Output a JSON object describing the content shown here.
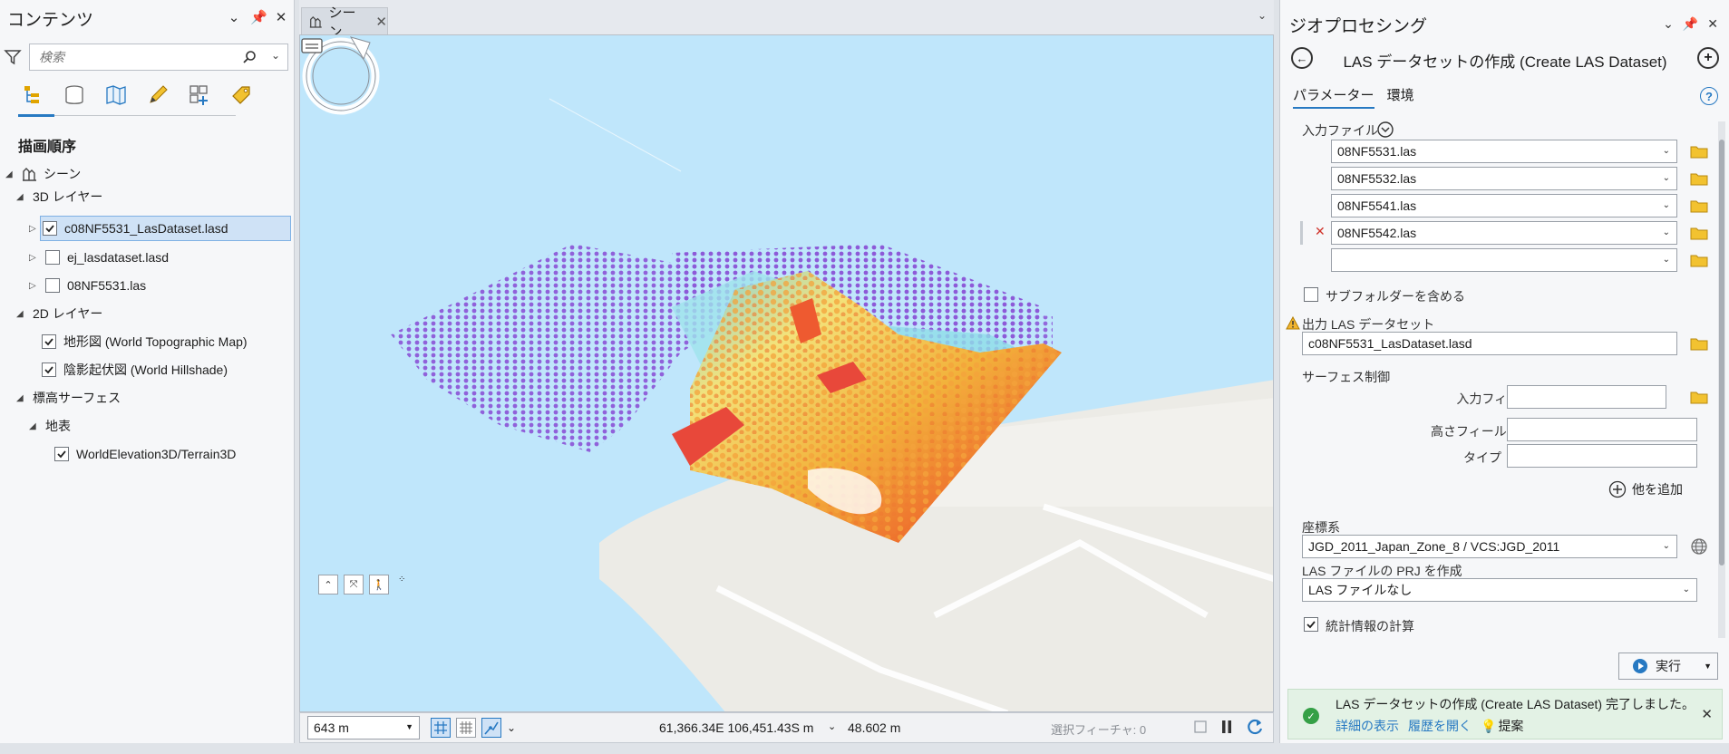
{
  "contents": {
    "title": "コンテンツ",
    "search_placeholder": "検索",
    "section_title": "描画順序",
    "tree": {
      "scene": "シーン",
      "layers_3d": "3D レイヤー",
      "layer_lasd_selected": "c08NF5531_LasDataset.lasd",
      "layer_ej_lasd": "ej_lasdataset.lasd",
      "layer_las": "08NF5531.las",
      "layers_2d": "2D レイヤー",
      "layer_topo": "地形図 (World Topographic Map)",
      "layer_hillshade": "陰影起伏図 (World Hillshade)",
      "elevation_surfaces": "標高サーフェス",
      "ground": "地表",
      "terrain": "WorldElevation3D/Terrain3D"
    }
  },
  "scene_view": {
    "tab_label": "シーン",
    "scale": "643 m",
    "coordinates": "61,366.34E 106,451.43S m",
    "elevation": "48.602 m",
    "selected_features": "選択フィーチャ: 0"
  },
  "geoprocessing": {
    "title": "ジオプロセシング",
    "tool_title": "LAS データセットの作成 (Create LAS Dataset)",
    "tabs": {
      "parameters": "パラメーター",
      "environments": "環境"
    },
    "input_files_label": "入力ファイル",
    "input_files": [
      "08NF5531.las",
      "08NF5532.las",
      "08NF5541.las",
      "08NF5542.las",
      ""
    ],
    "include_subfolders": "サブフォルダーを含める",
    "output_label": "出力 LAS データセット",
    "output_value": "c08NF5531_LasDataset.lasd",
    "surface_constraints": "サーフェス制御",
    "input_feature_label": "入力フィーチャ",
    "height_field_label": "高さフィールド",
    "type_label": "タイプ",
    "add_another": "他を追加",
    "coordinate_system_label": "座標系",
    "coordinate_system_value": "JGD_2011_Japan_Zone_8 / VCS:JGD_2011",
    "create_prj_label": "LAS ファイルの PRJ を作成",
    "create_prj_value": "LAS ファイルなし",
    "compute_stats": "統計情報の計算",
    "run_label": "実行",
    "message": "LAS データセットの作成 (Create LAS Dataset) 完了しました。",
    "link_details": "詳細の表示",
    "link_history": "履歴を開く",
    "link_suggest": "提案"
  },
  "colors": {
    "accent": "#2779c2",
    "water": "#bfe6fb",
    "success": "#35a046"
  }
}
